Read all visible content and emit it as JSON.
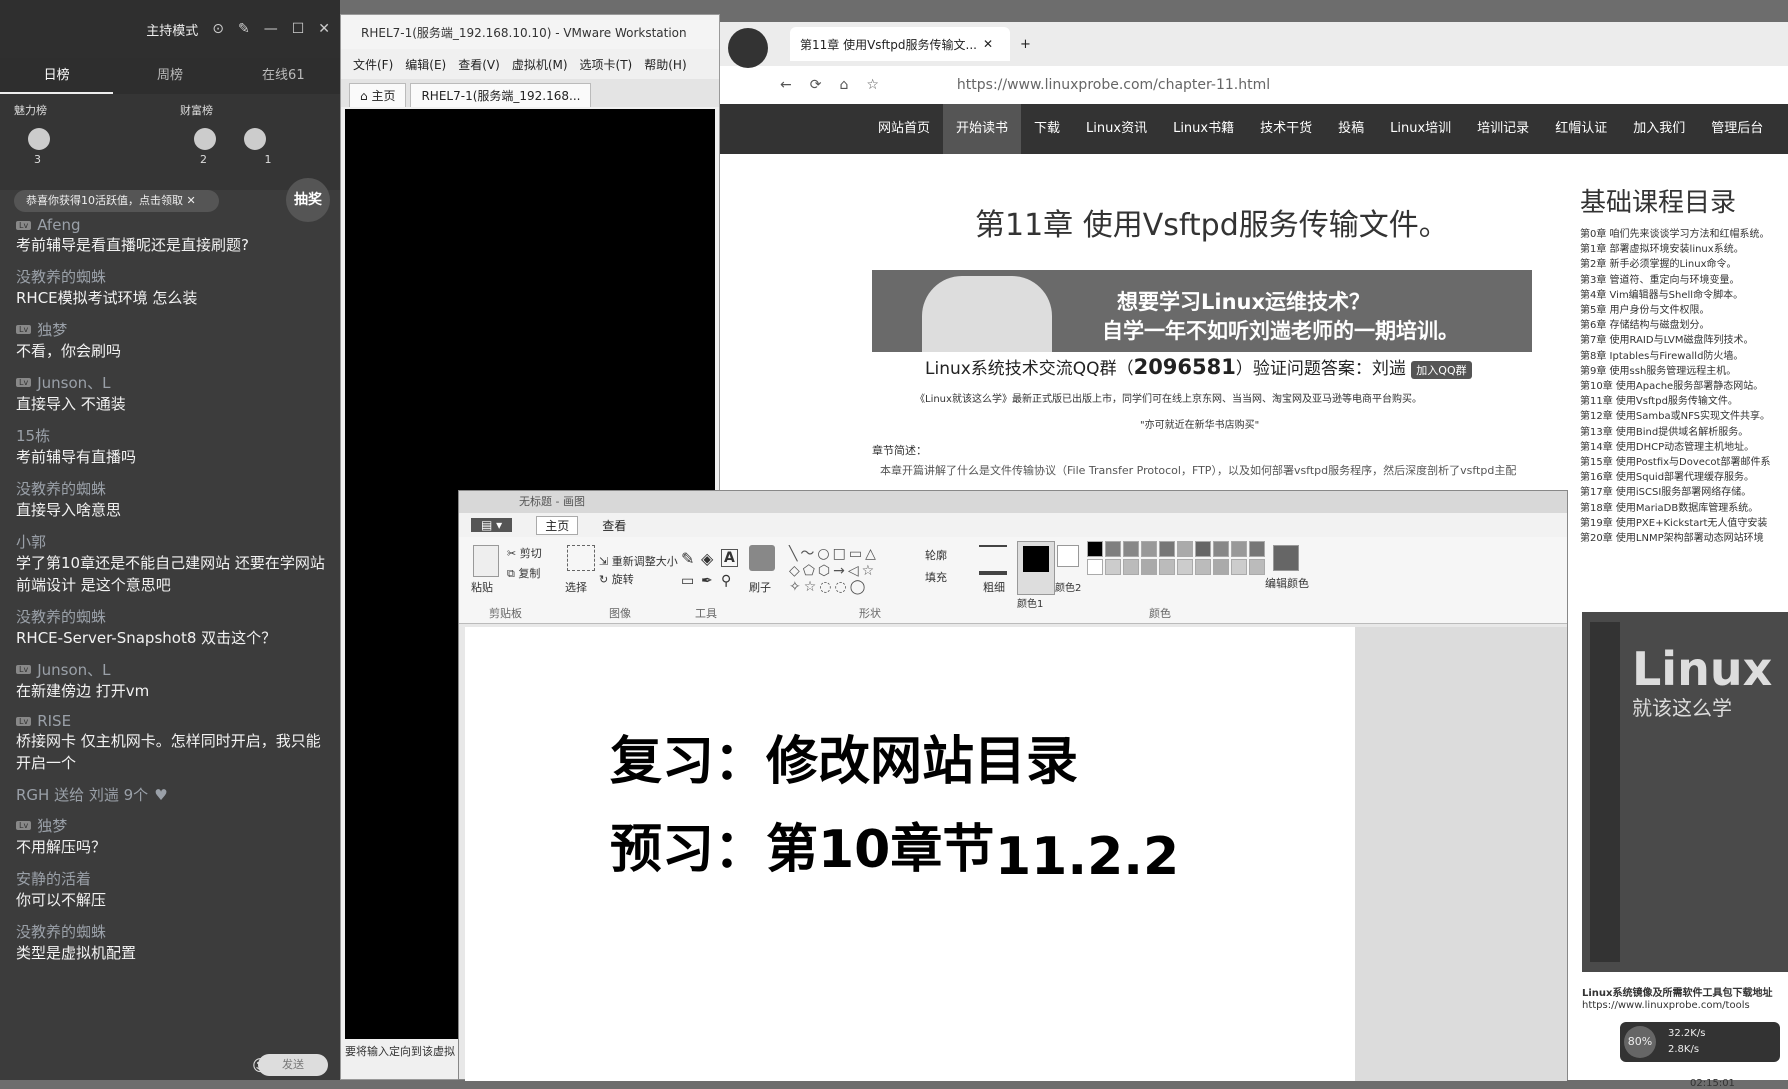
{
  "chat": {
    "mode": "主持模式",
    "tabs": [
      "日榜",
      "周榜",
      "在线61"
    ],
    "ranks": {
      "left": "魅力榜",
      "right": "财富榜",
      "nums": [
        "3",
        "2",
        "1"
      ]
    },
    "toast": "恭喜你获得10活跃值，点击领取",
    "lottery": "抽奖",
    "messages": [
      {
        "user": "Afeng",
        "text": "考前辅导是看直播呢还是直接刷题?"
      },
      {
        "user": "没教养的蜘蛛",
        "text": "RHCE模拟考试环境 怎么装"
      },
      {
        "user": "独梦",
        "text": "不看，你会刷吗"
      },
      {
        "user": "Junson、L",
        "text": "直接导入 不通装"
      },
      {
        "user": "15栋",
        "text": "考前辅导有直播吗"
      },
      {
        "user": "没教养的蜘蛛",
        "text": "直接导入啥意思"
      },
      {
        "user": "小郭",
        "text": "学了第10章还是不能自己建网站 还要在学网站前端设计 是这个意思吧"
      },
      {
        "user": "没教养的蜘蛛",
        "text": "RHCE-Server-Snapshot8 双击这个？"
      },
      {
        "user": "Junson、L",
        "text": "在新建傍边 打开vm"
      },
      {
        "user": "RISE",
        "text": "桥接网卡 仅主机网卡。怎样同时开启，我只能开启一个"
      },
      {
        "user": "RGH 送给 刘遄 9个",
        "text": ""
      },
      {
        "user": "独梦",
        "text": "不用解压吗？"
      },
      {
        "user": "安静的活着",
        "text": "你可以不解压"
      },
      {
        "user": "没教养的蜘蛛",
        "text": "类型是虚拟机配置"
      }
    ],
    "send": "发送"
  },
  "vmware": {
    "title": "RHEL7-1(服务端_192.168.10.10) - VMware Workstation",
    "menu": [
      "文件(F)",
      "编辑(E)",
      "查看(V)",
      "虚拟机(M)",
      "选项卡(T)",
      "帮助(H)"
    ],
    "tabs": [
      "主页",
      "RHEL7-1(服务端_192.168..."
    ],
    "status": "要将输入定向到该虚拟"
  },
  "browser": {
    "tab_title": "第11章 使用Vsftpd服务传输文...",
    "url": "https://www.linuxprobe.com/chapter-11.html",
    "nav": [
      "网站首页",
      "开始读书",
      "下载",
      "Linux资讯",
      "Linux书籍",
      "技术干货",
      "投稿",
      "Linux培训",
      "培训记录",
      "红帽认证",
      "加入我们",
      "管理后台"
    ],
    "heading": "第11章 使用Vsftpd服务传输文件。",
    "banner_l1": "想要学习Linux运维技术？",
    "banner_l2": "自学一年不如听刘遄老师的一期培训。",
    "qq_text": "Linux系统技术交流QQ群（",
    "qq_num": "2096581",
    "qq_tail": "）验证问题答案：刘遄",
    "qq_btn": "加入QQ群",
    "notice": "《Linux就该这么学》最新正式版已出版上市，同学们可在线上京东网、当当网、淘宝网及亚马逊等电商平台购买。",
    "notice2": "\"亦可就近在新华书店购买\"",
    "section": "章节简述：",
    "section_text": "本章开篇讲解了什么是文件传输协议（File Transfer Protocol，FTP），以及如何部署vsftpd服务程序，然后深度剖析了vsftpd主配",
    "sidebar_title": "基础课程目录",
    "sidebar": [
      "第0章 咱们先来谈谈学习方法和红帽系统。",
      "第1章 部署虚拟环境安装linux系统。",
      "第2章 新手必须掌握的Linux命令。",
      "第3章 管道符、重定向与环境变量。",
      "第4章 Vim编辑器与Shell命令脚本。",
      "第5章 用户身份与文件权限。",
      "第6章 存储结构与磁盘划分。",
      "第7章 使用RAID与LVM磁盘阵列技术。",
      "第8章 Iptables与Firewalld防火墙。",
      "第9章 使用ssh服务管理远程主机。",
      "第10章 使用Apache服务部署静态网站。",
      "第11章 使用Vsftpd服务传输文件。",
      "第12章 使用Samba或NFS实现文件共享。",
      "第13章 使用Bind提供域名解析服务。",
      "第14章 使用DHCP动态管理主机地址。",
      "第15章 使用Postfix与Dovecot部署邮件系",
      "第16章 使用Squid部署代理缓存服务。",
      "第17章 使用iSCSI服务部署网络存储。",
      "第18章 使用MariaDB数据库管理系统。",
      "第19章 使用PXE+Kickstart无人值守安装",
      "第20章 使用LNMP架构部署动态网站环境"
    ],
    "book_title": "Linux",
    "book_sub": "就该这么学",
    "book_note": "Linux系统镜像及所需软件工具包下载地址",
    "book_url": "https://www.linuxprobe.com/tools",
    "speed_pct": "80%",
    "speed_up": "32.2K/s",
    "speed_down": "2.8K/s",
    "clock": "02:15:01"
  },
  "paint": {
    "title": "无标题 - 画图",
    "tabs": [
      "主页",
      "查看"
    ],
    "groups": [
      "剪贴板",
      "图像",
      "工具",
      "形状",
      "颜色"
    ],
    "buttons": {
      "paste": "粘贴",
      "cut": "剪切",
      "copy": "复制",
      "select": "选择",
      "resize": "重新调整大小",
      "rotate": "旋转",
      "brush": "刷子",
      "outline": "轮廓",
      "fill": "填充",
      "size": "粗细",
      "color1": "颜色1",
      "color2": "颜色2",
      "edit_colors": "编辑颜色"
    },
    "line1": "复习：修改网站目录",
    "line2": "预习：第10章节",
    "line3": "11.2.2"
  }
}
